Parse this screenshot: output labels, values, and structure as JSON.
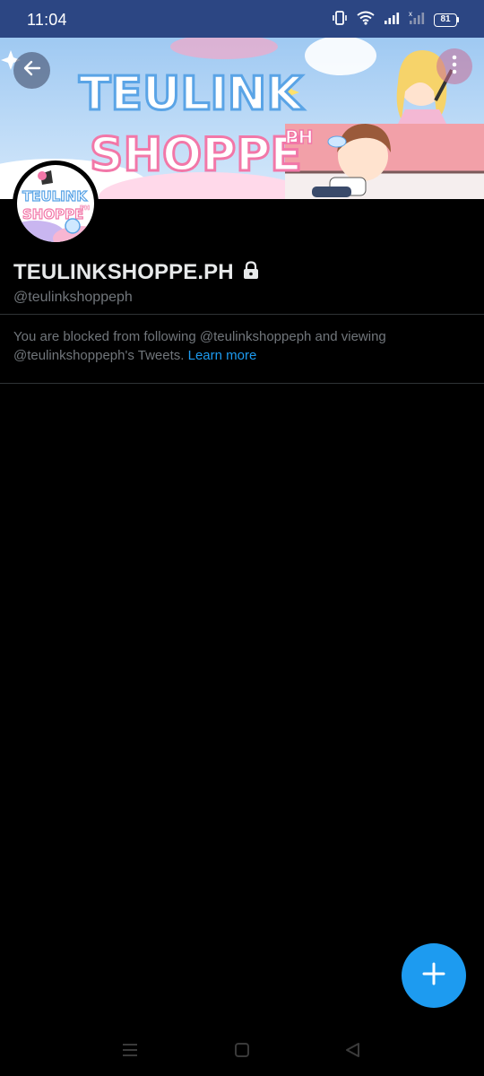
{
  "status_bar": {
    "time": "11:04",
    "battery": "81"
  },
  "banner": {
    "line1": "TEULINK",
    "line2": "SHOPPE",
    "suffix": "PH"
  },
  "avatar": {
    "line1": "TEULINK",
    "line2": "SHOPPE",
    "suffix": "PH"
  },
  "profile": {
    "display_name": "TEULINKSHOPPE.PH",
    "handle": "@teulinkshoppeph",
    "protected": true
  },
  "blocked_notice": {
    "text": "You are blocked from following @teulinkshoppeph and viewing @teulinkshoppeph's Tweets.",
    "link_label": "Learn more"
  },
  "colors": {
    "status_bar_bg": "#2c4683",
    "accent": "#1d9bf0",
    "background": "#000000",
    "text_primary": "#e7e9ea",
    "text_secondary": "#71767b",
    "divider": "#2f3336"
  },
  "icons": {
    "back": "arrow-left-icon",
    "more": "more-vertical-icon",
    "lock": "lock-icon",
    "compose": "plus-icon",
    "nav_menu": "menu-icon",
    "nav_home": "square-icon",
    "nav_back": "triangle-back-icon"
  }
}
